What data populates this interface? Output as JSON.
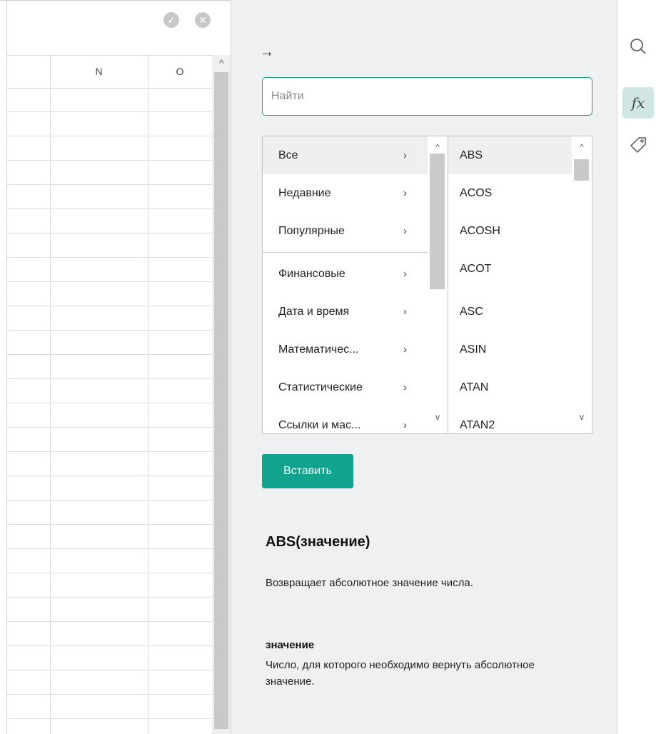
{
  "spreadsheet": {
    "formula_bar": {
      "confirm_icon": "check-icon",
      "cancel_icon": "x-icon"
    },
    "columns": [
      "N",
      "O"
    ],
    "scroll_up_icon": "caret-up-icon"
  },
  "function_panel": {
    "back_icon": "arrow-right-icon",
    "search": {
      "placeholder": "Найти",
      "value": ""
    },
    "categories": [
      {
        "label": "Все",
        "selected": true
      },
      {
        "label": "Недавние"
      },
      {
        "label": "Популярные"
      },
      {
        "label": "Финансовые"
      },
      {
        "label": "Дата и время"
      },
      {
        "label": "Математичес..."
      },
      {
        "label": "Статистические"
      },
      {
        "label": "Ссылки и мас..."
      }
    ],
    "functions": [
      {
        "label": "ABS",
        "selected": true
      },
      {
        "label": "ACOS"
      },
      {
        "label": "ACOSH"
      },
      {
        "label": "ACOT"
      },
      {
        "label": "ASC"
      },
      {
        "label": "ASIN"
      },
      {
        "label": "ATAN"
      },
      {
        "label": "ATAN2"
      }
    ],
    "insert_label": "Вставить",
    "help": {
      "signature": "ABS(значение)",
      "description": "Возвращает абсолютное значение числа.",
      "arg_name": "значение",
      "arg_description": "Число, для которого необходимо вернуть абсолютное значение."
    }
  },
  "sidebar_icons": [
    "search-icon",
    "function-fx-icon",
    "tag-icon"
  ],
  "colors": {
    "accent": "#12a38e",
    "panel_bg": "#eef0f2",
    "active_icon_bg": "#cfe6e3"
  }
}
